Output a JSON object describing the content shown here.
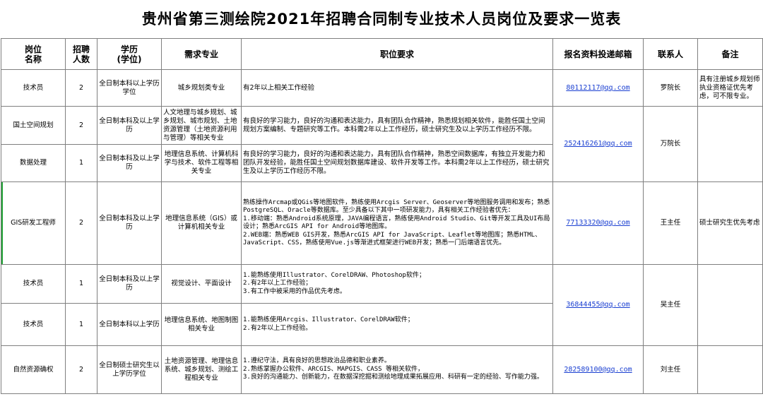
{
  "title": "贵州省第三测绘院2021年招聘合同制专业技术人员岗位及要求一览表",
  "headers": {
    "post": "岗位\n名称",
    "count": "招聘\n人数",
    "edu": "学历\n(学位)",
    "major": "需求专业",
    "req": "职位要求",
    "email": "报名资料投递邮箱",
    "contact": "联系人",
    "note": "备注"
  },
  "rows": [
    {
      "post": "技术员",
      "count": "2",
      "edu": "全日制本科以上学历学位",
      "major": "城乡规划类专业",
      "req": "有2年以上相关工作经验",
      "email": "80112117@qq.com",
      "contact": "罗院长",
      "note": "具有注册城乡规划师执业资格证优先考虑，可不限专业。"
    },
    {
      "post": "国土空间规划",
      "count": "2",
      "edu": "全日制本科及以上学历",
      "major": "人文地理与城乡规划、城乡规划、城市规划、土地资源管理（土地资源利用与管理）等相关专业",
      "req": "有良好的学习能力，良好的沟通和表达能力，具有团队合作精神，熟悉规划相关软件，能胜任国土空间规划方案编制、专题研究等工作。本科需2年以上工作经历，硕士研究生及以上学历工作经历不限。",
      "email": "252416261@qq.com",
      "contact": "万院长",
      "note": ""
    },
    {
      "post": "数据处理",
      "count": "1",
      "edu": "全日制本科及以上学历",
      "major": "地理信息系统、计算机科学与技术、软件工程等相关专业",
      "req": "有良好的学习能力，良好的沟通和表达能力，具有团队合作精神，熟悉空间数据库，有独立开发能力和团队开发经验，能胜任国土空间规划数据库建设、软件开发等工作。本科需2年以上工作经历，硕士研究生及以上学历工作经历不限。",
      "email": "",
      "contact": "",
      "note": ""
    },
    {
      "post": "GIS研发工程师",
      "count": "2",
      "edu": "全日制本科及以上学历",
      "major": "地理信息系统（GIS）或计算机相关专业",
      "req": "熟练操作Arcmap或QGis等地图软件，熟练使用Arcgis Server、Geoserver等地图服务调用和发布；熟悉PostgreSQL、Oracle等数据库。至少具备以下其中一项研发能力，具有相关工作经验者优先：\n1.移动端：熟悉Android系统原理，JAVA编程语言，熟练使用Android Studio、Git等开发工具及UI布局设计；熟悉ArcGIS API for Android等地图库。\n2.WEB端：熟悉WEB GIS开发，熟悉ArcGIS API for JavaScript、Leaflet等地图库；熟悉HTML、JavaScript、CSS，熟练使用Vue.js等渐进式框架进行WEB开发；熟悉一门后端语言优先。",
      "email": "77133320@qq.com",
      "contact": "王主任",
      "note": "硕士研究生优先考虑"
    },
    {
      "post": "技术员",
      "count": "1",
      "edu": "全日制本科及以上学历",
      "major": "视觉设计、平面设计",
      "req": "1.能熟练使用Illustrator、CorelDRAW、Photoshop软件；\n2.有2年以上工作经验；\n3.有工作中被采用的作品优先考虑。",
      "email": "36844455@qq.com",
      "contact": "吴主任",
      "note": ""
    },
    {
      "post": "技术员",
      "count": "1",
      "edu": "全日制本科以上学历",
      "major": "地理信息系统、地图制图相关专业",
      "req": "1.能熟练使用Arcgis、Illustrator、CorelDRAW软件；\n2.有2年以上工作经验。",
      "email": "",
      "contact": "",
      "note": ""
    },
    {
      "post": "自然资源确权",
      "count": "2",
      "edu": "全日制硕士研究生以上学历学位",
      "major": "土地资源管理、地理信息系统、城乡规划、测绘工程相关专业",
      "req": "1.遵纪守法，具有良好的思想政治品德和职业素养。\n2.熟练掌握办公软件、ARCGIS、MAPGIS、CASS 等相关软件，\n3.良好的沟通能力、创新能力，在数据深挖掘和测绘地理成果拓展应用、科研有一定的经验、写作能力强。",
      "email": "282589100@qq.com",
      "contact": "刘主任",
      "note": ""
    }
  ]
}
